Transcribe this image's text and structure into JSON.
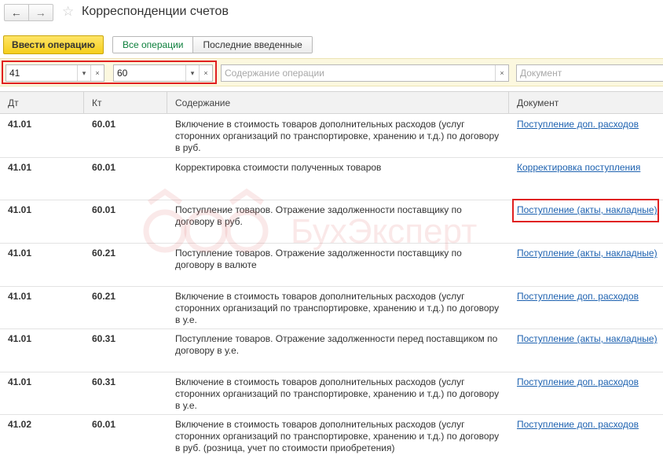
{
  "window": {
    "title": "Корреспонденции счетов",
    "nav_back": "←",
    "nav_forward": "→",
    "star": "☆"
  },
  "toolbar": {
    "primary_button": "Ввести операцию",
    "tabs": [
      "Все операции",
      "Последние введенные"
    ],
    "active_tab": "Все операции"
  },
  "filters": {
    "dt_value": "41",
    "kt_value": "60",
    "content_placeholder": "Содержание операции",
    "document_placeholder": "Документ",
    "dropdown_glyph": "▾",
    "clear_glyph": "×"
  },
  "table": {
    "headers": {
      "dt": "Дт",
      "kt": "Кт",
      "content": "Содержание",
      "document": "Документ"
    },
    "rows": [
      {
        "dt": "41.01",
        "kt": "60.01",
        "content": "Включение в стоимость товаров дополнительных расходов (услуг сторонних организаций по транспортировке, хранению и т.д.) по договору в руб.",
        "document": "Поступление доп. расходов"
      },
      {
        "dt": "41.01",
        "kt": "60.01",
        "content": "Корректировка стоимости полученных товаров",
        "document": "Корректировка поступления"
      },
      {
        "dt": "41.01",
        "kt": "60.01",
        "content": "Поступление товаров. Отражение задолженности поставщику по договору в руб.",
        "document": "Поступление (акты, накладные)"
      },
      {
        "dt": "41.01",
        "kt": "60.21",
        "content": "Поступление товаров. Отражение задолженности поставщику по договору в валюте",
        "document": "Поступление (акты, накладные)"
      },
      {
        "dt": "41.01",
        "kt": "60.21",
        "content": "Включение в стоимость товаров дополнительных расходов (услуг сторонних организаций по транспортировке, хранению и т.д.) по договору в у.е.",
        "document": "Поступление доп. расходов"
      },
      {
        "dt": "41.01",
        "kt": "60.31",
        "content": "Поступление товаров. Отражение задолженности перед поставщиком по договору в у.е.",
        "document": "Поступление (акты, накладные)"
      },
      {
        "dt": "41.01",
        "kt": "60.31",
        "content": "Включение в стоимость товаров дополнительных расходов (услуг сторонних организаций по транспортировке, хранению и т.д.) по договору в у.е.",
        "document": "Поступление доп. расходов"
      },
      {
        "dt": "41.02",
        "kt": "60.01",
        "content": "Включение в стоимость товаров дополнительных расходов (услуг сторонних организаций по транспортировке, хранению и т.д.) по договору в руб. (розница, учет по стоимости приобретения)",
        "document": "Поступление доп. расходов"
      }
    ]
  },
  "watermark": {
    "text": "БухЭксперт",
    "color": "#e07a7a"
  },
  "colors": {
    "accent_yellow": "#f5cf1c",
    "link_blue": "#1e62b0",
    "active_tab_green": "#0b7f3b",
    "highlight_red": "#e02020",
    "filter_bg": "#fcf8df"
  }
}
